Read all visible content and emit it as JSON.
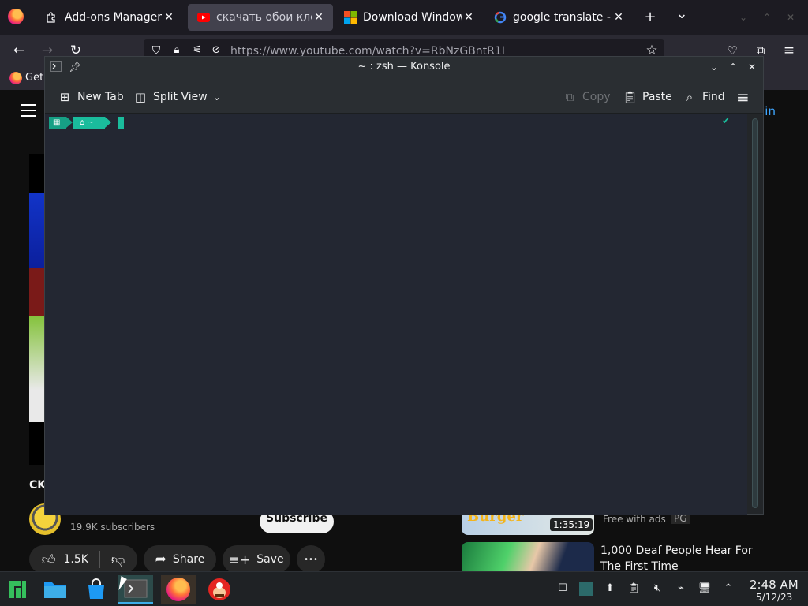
{
  "browser": {
    "tabs": [
      {
        "title": "Add-ons Manager",
        "icon": "puzzle-icon",
        "active": false
      },
      {
        "title": "скачать обои клеш",
        "icon": "youtube-icon",
        "active": true
      },
      {
        "title": "Download Windows",
        "icon": "microsoft-icon",
        "active": false
      },
      {
        "title": "google translate - Go",
        "icon": "google-icon",
        "active": false
      }
    ],
    "close_glyph": "✕",
    "new_tab_glyph": "+",
    "tab_list_glyph": "⌄",
    "url": "https://www.youtube.com/watch?v=RbNzGBntR1I",
    "bookmark_label": "Get"
  },
  "youtube": {
    "sign_in": "n in",
    "title_fragment": "CK",
    "subscribers": "19.9K subscribers",
    "subscribe": "Subscribe",
    "likes": "1.5K",
    "share": "Share",
    "save": "Save",
    "more": "•••",
    "rec1": {
      "thumb_text": "Burger",
      "duration": "1:35:19",
      "free_label": "Free with ads",
      "rating": "PG"
    },
    "rec2": {
      "title": "1,000 Deaf People Hear For The First Time"
    }
  },
  "konsole": {
    "window_title": "~ : zsh — Konsole",
    "toolbar": {
      "new_tab": "New Tab",
      "split_view": "Split View",
      "copy": "Copy",
      "paste": "Paste",
      "find": "Find"
    },
    "prompt": {
      "segment1": "▦",
      "segment2": "⌂ ~",
      "status": "✔"
    }
  },
  "taskbar": {
    "clock_time": "2:48 AM",
    "clock_date": "5/12/23"
  }
}
